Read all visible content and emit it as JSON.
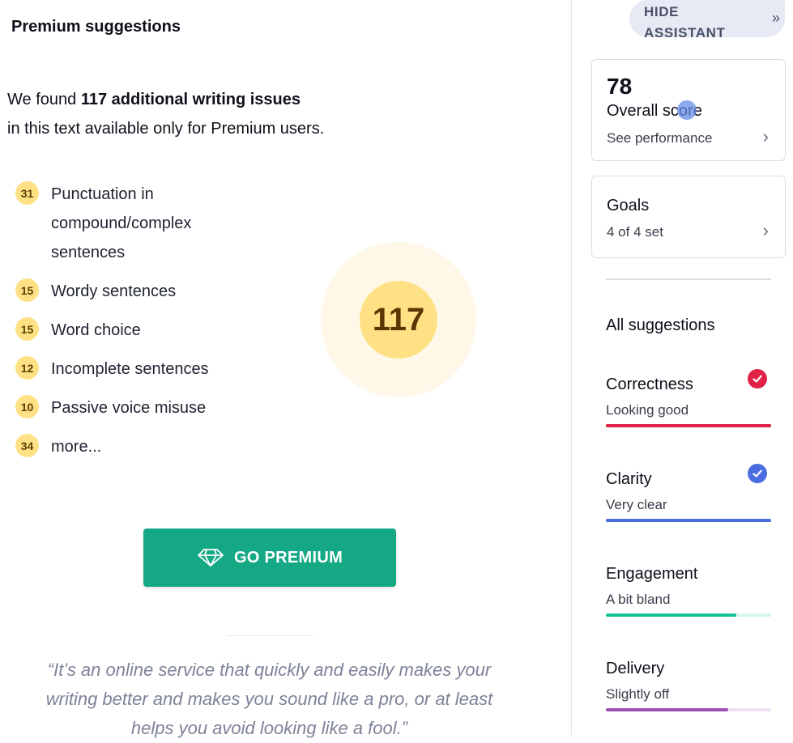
{
  "premium": {
    "title": "Premium suggestions",
    "intro_prefix": "We found ",
    "intro_bold": "117 additional writing issues",
    "intro_suffix": "in this text available only for Premium users.",
    "issues": [
      {
        "count": "31",
        "label": "Punctuation in compound/complex sentences"
      },
      {
        "count": "15",
        "label": "Wordy sentences"
      },
      {
        "count": "15",
        "label": "Word choice"
      },
      {
        "count": "12",
        "label": "Incomplete sentences"
      },
      {
        "count": "10",
        "label": "Passive voice misuse"
      },
      {
        "count": "34",
        "label": "more..."
      }
    ],
    "total": "117",
    "button_label": "GO PREMIUM",
    "button_icon": "diamond-icon",
    "quote": "“It’s an online service that quickly and easily makes your writing better and makes you sound like a pro, or at least helps you avoid looking like a fool.”"
  },
  "assistant": {
    "hide_label": "HIDE ASSISTANT",
    "hide_icon": "double-chevron-right-icon",
    "score": {
      "value": "78",
      "label": "Overall score",
      "link": "See performance"
    },
    "goals": {
      "label": "Goals",
      "status": "4 of 4 set"
    },
    "all_suggestions": "All suggestions",
    "categories": [
      {
        "name": "Correctness",
        "status": "Looking good",
        "color": "#e22147",
        "track": "#e22147",
        "level": 1.0,
        "check": true
      },
      {
        "name": "Clarity",
        "status": "Very clear",
        "color": "#4a6ee0",
        "track": "#4a6ee0",
        "level": 1.0,
        "check": true
      },
      {
        "name": "Engagement",
        "status": "A bit bland",
        "color": "#15c39a",
        "track": "#d4f5ec",
        "level": 0.79,
        "check": false
      },
      {
        "name": "Delivery",
        "status": "Slightly off",
        "color": "#9b51b7",
        "track": "#efe2f7",
        "level": 0.74,
        "check": false
      }
    ]
  },
  "colors": {
    "premium_green": "#15a884",
    "badge_yellow": "#ffe185",
    "quote_gray": "#7e8299"
  }
}
